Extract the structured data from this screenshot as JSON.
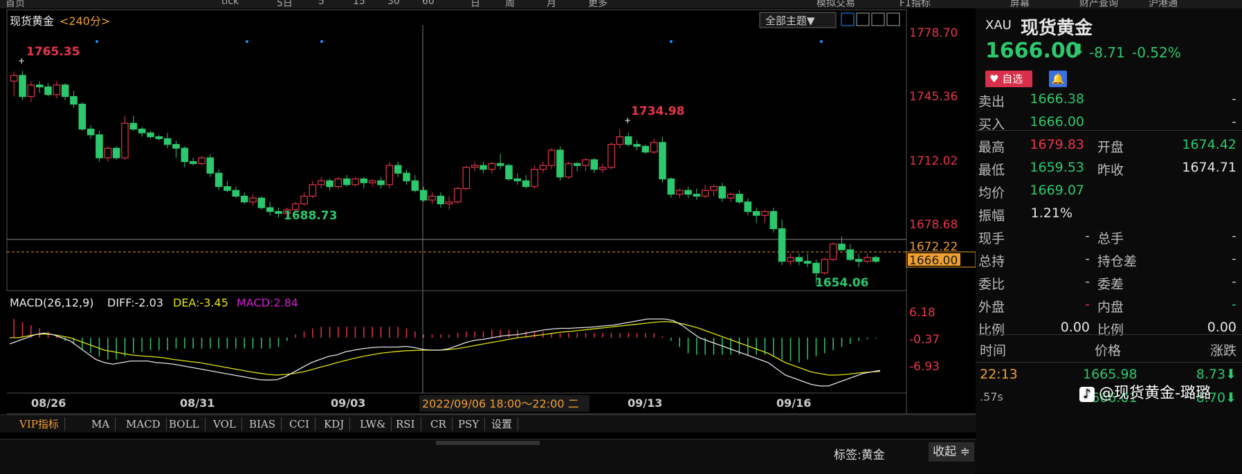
{
  "toolbar": {
    "items": [
      "首页",
      "",
      "",
      "tick",
      "5日",
      "5",
      "15",
      "30",
      "60",
      "日",
      "周",
      "月",
      "更多",
      "",
      "",
      "",
      "",
      "模拟交易",
      "F1指标",
      "屏幕",
      "财产查询",
      "沪港通"
    ]
  },
  "chart": {
    "title": "现货黄金",
    "period": "<240分>",
    "themes_label": "全部主题▼",
    "price_labels": [
      "1778.70",
      "1745.36",
      "1712.02",
      "1678.68",
      "1672.22",
      "1666.00"
    ],
    "annotations": {
      "high1": "1765.35",
      "high2": "1734.98",
      "low1": "1688.73",
      "low2": "1654.06"
    },
    "date_labels": [
      "08/26",
      "08/31",
      "09/03",
      "09/13",
      "09/16"
    ],
    "crosshair_label": "2022/09/06 18:00～22:00 二",
    "macd": {
      "title": "MACD(26,12,9)",
      "diff": "DIFF:-2.03",
      "dea": "DEA:-3.45",
      "macd": "MACD:2.84",
      "levels": [
        "6.18",
        "-0.37",
        "-6.93"
      ]
    }
  },
  "chart_data": {
    "type": "candlestick",
    "ylim": [
      1650,
      1785
    ],
    "candles": [
      [
        1760,
        1765,
        1752,
        1763
      ],
      [
        1763,
        1765.35,
        1750,
        1752
      ],
      [
        1752,
        1760,
        1749,
        1758
      ],
      [
        1758,
        1760,
        1754,
        1757
      ],
      [
        1757,
        1759,
        1752,
        1753
      ],
      [
        1753,
        1760,
        1751,
        1758
      ],
      [
        1758,
        1759,
        1750,
        1752
      ],
      [
        1752,
        1755,
        1746,
        1748
      ],
      [
        1748,
        1749,
        1734,
        1735
      ],
      [
        1735,
        1737,
        1730,
        1732
      ],
      [
        1732,
        1734,
        1718,
        1720
      ],
      [
        1720,
        1726,
        1718,
        1725
      ],
      [
        1725,
        1726,
        1719,
        1720
      ],
      [
        1720,
        1742,
        1719,
        1738
      ],
      [
        1738,
        1742,
        1734,
        1735
      ],
      [
        1735,
        1736,
        1731,
        1733
      ],
      [
        1733,
        1734,
        1730,
        1731
      ],
      [
        1731,
        1732,
        1729,
        1730
      ],
      [
        1730,
        1733,
        1725,
        1727
      ],
      [
        1727,
        1729,
        1720,
        1725
      ],
      [
        1725,
        1726,
        1715,
        1718
      ],
      [
        1718,
        1720,
        1716,
        1717
      ],
      [
        1717,
        1721,
        1716,
        1720
      ],
      [
        1720,
        1722,
        1710,
        1712
      ],
      [
        1712,
        1714,
        1703,
        1705
      ],
      [
        1705,
        1708,
        1702,
        1703
      ],
      [
        1703,
        1705,
        1699,
        1700
      ],
      [
        1700,
        1702,
        1696,
        1697
      ],
      [
        1697,
        1701,
        1695,
        1699
      ],
      [
        1699,
        1700,
        1693,
        1694
      ],
      [
        1694,
        1697,
        1690,
        1692
      ],
      [
        1692,
        1694,
        1688.73,
        1691
      ],
      [
        1691,
        1694,
        1689,
        1693
      ],
      [
        1693,
        1697,
        1692,
        1696
      ],
      [
        1696,
        1702,
        1695,
        1700
      ],
      [
        1700,
        1708,
        1699,
        1706
      ],
      [
        1706,
        1710,
        1704,
        1708
      ],
      [
        1708,
        1709,
        1703,
        1705
      ],
      [
        1705,
        1710,
        1704,
        1709
      ],
      [
        1709,
        1711,
        1705,
        1706
      ],
      [
        1706,
        1710,
        1705,
        1709
      ],
      [
        1709,
        1710,
        1704,
        1707
      ],
      [
        1707,
        1709,
        1705,
        1708
      ],
      [
        1708,
        1710,
        1704,
        1706
      ],
      [
        1706,
        1718,
        1704,
        1716
      ],
      [
        1716,
        1718,
        1710,
        1712
      ],
      [
        1712,
        1714,
        1706,
        1708
      ],
      [
        1708,
        1711,
        1702,
        1703
      ],
      [
        1703,
        1705,
        1697,
        1698
      ],
      [
        1698,
        1702,
        1696,
        1700
      ],
      [
        1700,
        1702,
        1694,
        1696
      ],
      [
        1696,
        1700,
        1693,
        1697
      ],
      [
        1697,
        1705,
        1696,
        1704
      ],
      [
        1704,
        1716,
        1703,
        1715
      ],
      [
        1715,
        1718,
        1713,
        1716
      ],
      [
        1716,
        1718,
        1712,
        1714
      ],
      [
        1714,
        1718,
        1712,
        1717
      ],
      [
        1717,
        1722,
        1714,
        1716
      ],
      [
        1716,
        1717,
        1708,
        1709
      ],
      [
        1709,
        1712,
        1706,
        1708
      ],
      [
        1708,
        1711,
        1704,
        1705
      ],
      [
        1705,
        1716,
        1704,
        1714
      ],
      [
        1714,
        1718,
        1712,
        1716
      ],
      [
        1716,
        1725,
        1714,
        1724
      ],
      [
        1724,
        1726,
        1708,
        1710
      ],
      [
        1710,
        1718,
        1709,
        1717
      ],
      [
        1717,
        1718,
        1713,
        1716
      ],
      [
        1716,
        1720,
        1713,
        1719
      ],
      [
        1719,
        1720,
        1712,
        1714
      ],
      [
        1714,
        1717,
        1712,
        1715
      ],
      [
        1715,
        1728,
        1714,
        1727
      ],
      [
        1727,
        1734.98,
        1725,
        1731
      ],
      [
        1731,
        1733,
        1726,
        1727
      ],
      [
        1727,
        1729,
        1724,
        1726
      ],
      [
        1726,
        1727,
        1722,
        1723
      ],
      [
        1723,
        1730,
        1722,
        1728
      ],
      [
        1728,
        1731,
        1707,
        1709
      ],
      [
        1709,
        1710,
        1699,
        1701
      ],
      [
        1701,
        1704,
        1699,
        1703
      ],
      [
        1703,
        1705,
        1699,
        1701
      ],
      [
        1701,
        1704,
        1698,
        1700
      ],
      [
        1700,
        1706,
        1699,
        1703
      ],
      [
        1703,
        1706,
        1700,
        1705
      ],
      [
        1705,
        1707,
        1697,
        1699
      ],
      [
        1699,
        1702,
        1697,
        1701
      ],
      [
        1701,
        1703,
        1696,
        1697
      ],
      [
        1697,
        1699,
        1690,
        1692
      ],
      [
        1692,
        1694,
        1686,
        1690
      ],
      [
        1690,
        1693,
        1686,
        1692
      ],
      [
        1692,
        1694,
        1681,
        1683
      ],
      [
        1683,
        1688,
        1664,
        1666
      ],
      [
        1666,
        1670,
        1664,
        1668
      ],
      [
        1668,
        1670,
        1664,
        1666
      ],
      [
        1666,
        1670,
        1663,
        1665
      ],
      [
        1665,
        1667,
        1654.06,
        1660
      ],
      [
        1660,
        1668,
        1659,
        1667
      ],
      [
        1667,
        1676,
        1666,
        1675
      ],
      [
        1675,
        1679,
        1672,
        1672
      ],
      [
        1672,
        1675,
        1666,
        1667
      ],
      [
        1667,
        1670,
        1663,
        1666
      ],
      [
        1666,
        1670,
        1665,
        1668
      ],
      [
        1668,
        1669,
        1665,
        1666
      ]
    ],
    "diff_line": [
      -2,
      -1,
      0,
      1,
      1.5,
      1,
      0,
      -1,
      -3,
      -5,
      -7,
      -8,
      -8.5,
      -8,
      -7.5,
      -7.5,
      -7.5,
      -8,
      -8.2,
      -8.5,
      -9,
      -9.5,
      -10,
      -10.5,
      -11,
      -11.5,
      -12,
      -12.5,
      -13,
      -13.5,
      -13.6,
      -13.5,
      -12.5,
      -11,
      -9.5,
      -8,
      -7,
      -6,
      -5.5,
      -4.5,
      -4,
      -3.5,
      -3.2,
      -3,
      -3,
      -3,
      -2.8,
      -3.2,
      -3.8,
      -4,
      -4,
      -3.5,
      -2.5,
      -1.5,
      -0.8,
      -0.5,
      0,
      0.5,
      0.8,
      1,
      1.5,
      2,
      2.5,
      2.8,
      3,
      3,
      3.2,
      3.3,
      3.5,
      3.8,
      4,
      4.5,
      5,
      5.5,
      6,
      6,
      6,
      5.5,
      4,
      2,
      0,
      -1,
      -2,
      -3,
      -4,
      -5,
      -6,
      -7,
      -8,
      -10,
      -12,
      -13,
      -14,
      -15,
      -15.5,
      -15.5,
      -14.5,
      -13.5,
      -12.5,
      -11.5,
      -11,
      -10.5
    ],
    "dea_line": [
      0,
      0,
      0.5,
      1,
      1.2,
      1,
      0.5,
      0,
      -1,
      -2,
      -3,
      -4,
      -4.5,
      -5,
      -5.5,
      -5.8,
      -6,
      -6.2,
      -6.5,
      -7,
      -7.3,
      -7.7,
      -8,
      -8.5,
      -9,
      -9.5,
      -10,
      -10.5,
      -11,
      -11.4,
      -11.8,
      -12,
      -11.8,
      -11.5,
      -11,
      -10.3,
      -9.5,
      -8.8,
      -8,
      -7.3,
      -6.6,
      -6,
      -5.5,
      -5,
      -4.7,
      -4.4,
      -4.2,
      -4.1,
      -4,
      -4,
      -4,
      -3.8,
      -3.5,
      -3,
      -2.5,
      -2,
      -1.5,
      -1,
      -0.5,
      0,
      0.3,
      0.7,
      1,
      1.4,
      1.8,
      2,
      2.3,
      2.6,
      2.9,
      3.2,
      3.5,
      3.8,
      4.1,
      4.4,
      4.7,
      5,
      5.2,
      5,
      4.5,
      3.8,
      3,
      2,
      1,
      0,
      -1,
      -2,
      -3,
      -4,
      -5,
      -6.5,
      -8,
      -9,
      -10,
      -11,
      -11.5,
      -12,
      -12,
      -11.8,
      -11.5,
      -11.2,
      -11,
      -10.8
    ],
    "macd_hist": [
      6,
      5,
      4,
      3,
      2,
      1,
      -1,
      -2,
      -4,
      -5,
      -6,
      -7,
      -7,
      -6,
      -5,
      -4.5,
      -4,
      -4,
      -4,
      -3.5,
      -3.5,
      -3.5,
      -3.5,
      -3.5,
      -3.5,
      -3.5,
      -3.5,
      -3.5,
      -3.5,
      -3.5,
      -3.5,
      -3,
      -1,
      1,
      2,
      3,
      3.5,
      3.5,
      3.5,
      3.5,
      3.5,
      3.5,
      3.5,
      3.5,
      3.5,
      3.5,
      3,
      2,
      1,
      1,
      1,
      1,
      1.5,
      2,
      2,
      2,
      2.5,
      2.5,
      2.5,
      2.5,
      2,
      2,
      2,
      1.5,
      1.5,
      1.5,
      1.5,
      1.5,
      1.5,
      1.5,
      1.5,
      1.5,
      1.5,
      1.5,
      1.5,
      1.5,
      0.5,
      -1,
      -3,
      -5,
      -5.5,
      -5.5,
      -5.5,
      -5.5,
      -5.5,
      -5.5,
      -5.5,
      -5.5,
      -5.5,
      -6,
      -7,
      -7.5,
      -8,
      -7,
      -6,
      -5,
      -4,
      -3,
      -2,
      -1,
      -0.5,
      -0.3
    ],
    "macd_ylim": [
      -16,
      8
    ]
  },
  "tabs": [
    "VIP指标",
    "MA",
    "MACD",
    "BOLL",
    "VOL",
    "BIAS",
    "CCI",
    "KDJ",
    "LW&",
    "RSI",
    "CR",
    "PSY",
    "设置"
  ],
  "bottom": {
    "tag_label": "标签:黄金",
    "collapse": "收起"
  },
  "right": {
    "symbol": "XAU",
    "name": "现货黄金",
    "price": "1666.00",
    "arrow": "⬇",
    "change": "-8.71",
    "pct": "-0.52%",
    "fav_label": "自选",
    "rows": [
      {
        "l": "卖出",
        "v": "1666.38",
        "l2": "",
        "v2": "-"
      },
      {
        "l": "买入",
        "v": "1666.00",
        "l2": "",
        "v2": "-"
      },
      {
        "l": "最高",
        "v": "1679.83",
        "l2": "开盘",
        "v2": "1674.42"
      },
      {
        "l": "最低",
        "v": "1659.53",
        "l2": "昨收",
        "v2": "1674.71"
      },
      {
        "l": "均价",
        "v": "1669.07",
        "l2": "",
        "v2": ""
      },
      {
        "l": "振幅",
        "v": "1.21%",
        "l2": "",
        "v2": ""
      },
      {
        "l": "现手",
        "v": "-",
        "l2": "总手",
        "v2": "-"
      },
      {
        "l": "总持",
        "v": "-",
        "l2": "持仓差",
        "v2": "-"
      },
      {
        "l": "委比",
        "v": "-",
        "l2": "委差",
        "v2": "-"
      },
      {
        "l": "外盘",
        "v": "-",
        "l2": "内盘",
        "v2": "-"
      },
      {
        "l": "比例",
        "v": "0.00",
        "l2": "比例",
        "v2": "0.00"
      }
    ],
    "ticks_header": [
      "时间",
      "价格",
      "涨跌"
    ],
    "ticks": [
      {
        "t": "22:13",
        "p": "1665.98",
        "c": "8.73⬇"
      },
      {
        "t": ".57s",
        "p": "1666.01",
        "c": "8.70⬇"
      }
    ],
    "watermark": "@现货黄金-璐璐"
  },
  "colors": {
    "up": "#e8354a",
    "down": "#2cc86d",
    "bg": "#000000",
    "diff": "#e6e6e6",
    "dea": "#e5e512",
    "macd": "#d020d0",
    "price_label": "#e8354a",
    "orange": "#f0a030"
  }
}
